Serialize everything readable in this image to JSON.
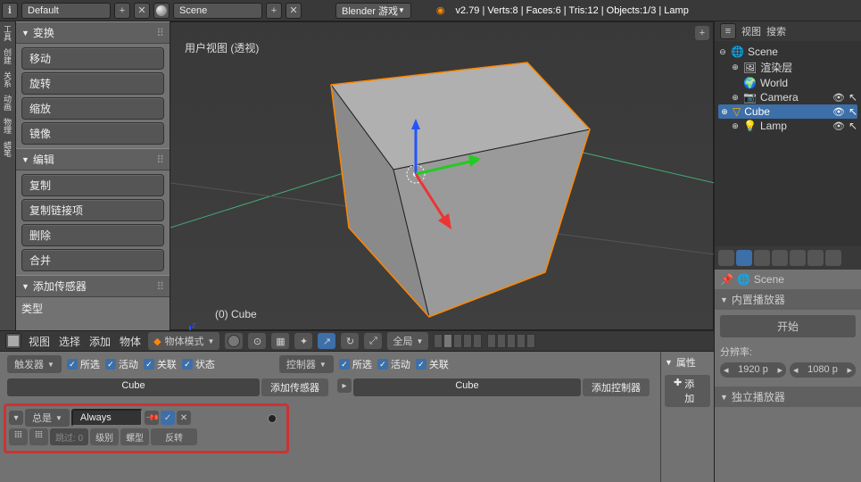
{
  "top": {
    "layout_label": "Default",
    "scene_label": "Scene",
    "engine_label": "Blender 游戏",
    "status": "v2.79 | Verts:8 | Faces:6 | Tris:12 | Objects:1/3 | Lamp"
  },
  "left_tabs": [
    "工具",
    "创建",
    "关系",
    "动画",
    "物理",
    "蜡笔"
  ],
  "left_panel": {
    "transform_header": "变换",
    "transform_buttons": [
      "移动",
      "旋转",
      "缩放",
      "镜像"
    ],
    "edit_header": "编辑",
    "edit_buttons": [
      "复制",
      "复制链接项",
      "删除",
      "合并"
    ],
    "sensor_header": "添加传感器",
    "type_label": "类型"
  },
  "viewport": {
    "title": "用户视图 (透视)",
    "object_label": "(0) Cube"
  },
  "vp_header": {
    "menus": [
      "视图",
      "选择",
      "添加",
      "物体"
    ],
    "mode": "物体模式",
    "orient": "全局"
  },
  "logic": {
    "sensor_dropdown": "触发器",
    "checks_left": [
      "所选",
      "活动",
      "关联",
      "状态"
    ],
    "controller_dropdown": "控制器",
    "checks_right": [
      "所选",
      "活动",
      "关联"
    ],
    "cube_label": "Cube",
    "add_sensor": "添加传感器",
    "add_controller": "添加控制器",
    "sensor_type": "总是",
    "sensor_name": "Always",
    "skip_label": "跳过:",
    "skip_value": "0",
    "sub_buttons": [
      "级别",
      "螺型",
      "反转"
    ],
    "props_header": "属性",
    "add_label": "添加"
  },
  "outliner": {
    "menus": [
      "视图",
      "搜索"
    ],
    "scene": "Scene",
    "render_layers": "渲染层",
    "world": "World",
    "camera": "Camera",
    "cube": "Cube",
    "lamp": "Lamp"
  },
  "props": {
    "breadcrumb": "Scene",
    "embedded_header": "内置播放器",
    "start_button": "开始",
    "res_label": "分辨率:",
    "res_x": "1920 p",
    "res_y": "1080 p",
    "standalone_header": "独立播放器"
  }
}
